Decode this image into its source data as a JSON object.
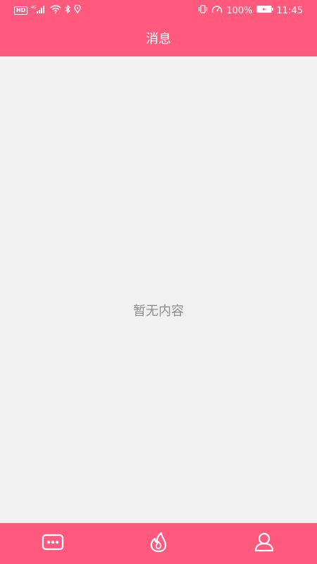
{
  "status_bar": {
    "hd_badge": "HD",
    "network": "4G",
    "battery": "100%",
    "time": "11:45",
    "icons": [
      "hd-badge-icon",
      "signal-icon",
      "wifi-icon",
      "bluetooth-icon",
      "location-icon",
      "vibrate-icon",
      "speed-icon",
      "battery-icon"
    ]
  },
  "header": {
    "title": "消息"
  },
  "main": {
    "empty_text": "暂无内容"
  },
  "bottom_nav": {
    "items": [
      {
        "icon": "chat-bubble-icon"
      },
      {
        "icon": "flame-icon"
      },
      {
        "icon": "user-icon"
      }
    ]
  },
  "colors": {
    "accent": "#ff5a7d",
    "background": "#f1f1f1",
    "empty_text": "#8e8e8e"
  }
}
